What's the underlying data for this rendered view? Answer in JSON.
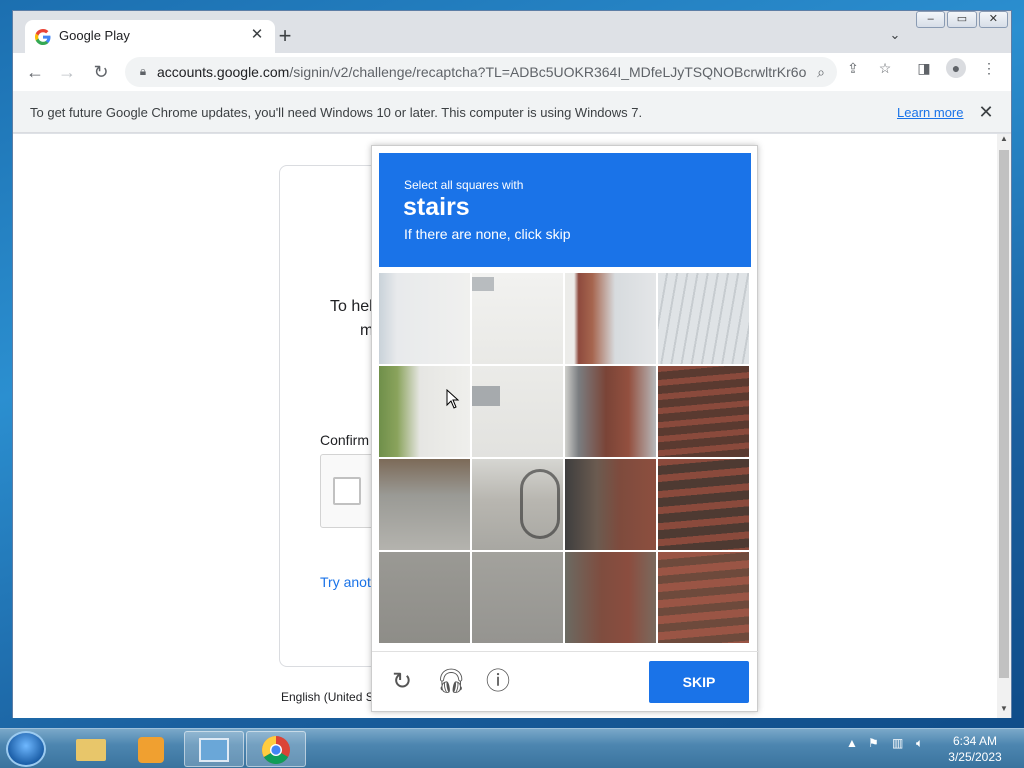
{
  "browser": {
    "tab_title": "Google Play",
    "url_host": "accounts.google.com",
    "url_path": "/signin/v2/challenge/recaptcha?TL=ADBc5UOKR364I_MDfeLJyTSQNOBcrwltrKr6o...",
    "window_controls": [
      "‒",
      "▭",
      "✕"
    ],
    "infobar_message": "To get future Google Chrome updates, you'll need Windows 10 or later. This computer is using Windows 7.",
    "infobar_link": "Learn more"
  },
  "page": {
    "bg_line1": "To hel",
    "bg_line2": "m",
    "confirm_label": "Confirm",
    "try_link": "Try anot",
    "footer_lang": "English (United S"
  },
  "captcha": {
    "instruction": "Select all squares with",
    "target": "stairs",
    "hint": "If there are none, click skip",
    "skip_label": "SKIP",
    "header_color": "#1a73e8"
  },
  "taskbar": {
    "time": "6:34 AM",
    "date": "3/25/2023"
  }
}
